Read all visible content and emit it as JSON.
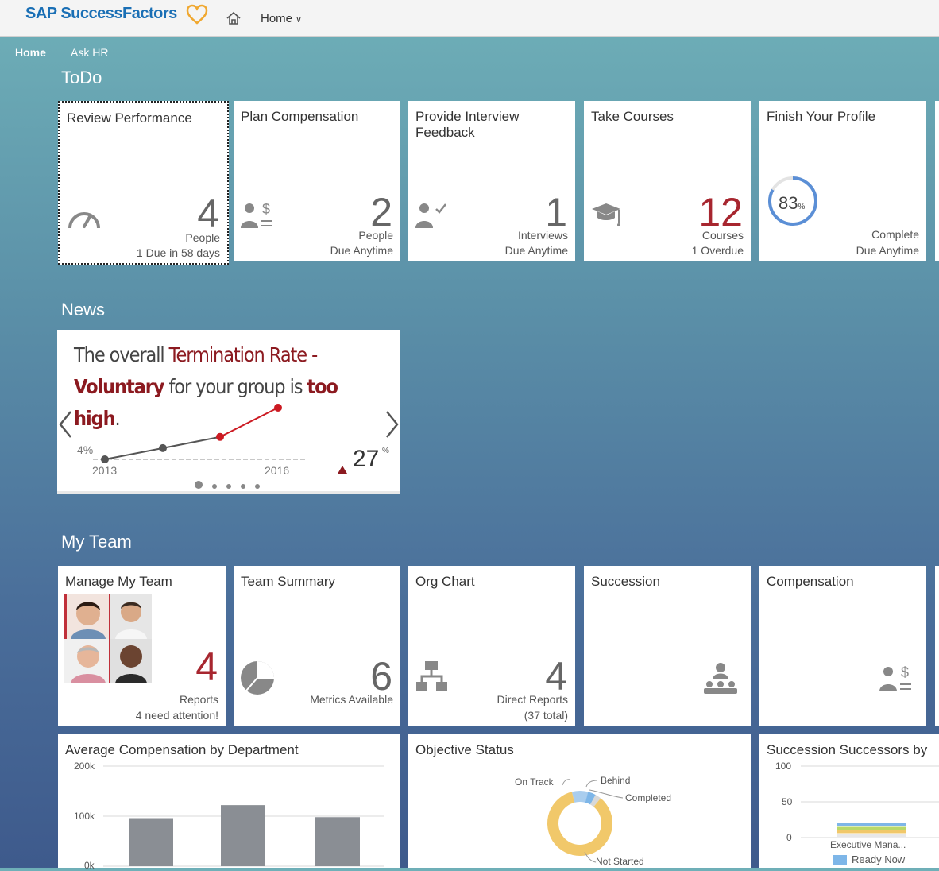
{
  "topbar": {
    "logo": "SAP SuccessFactors",
    "home_menu": "Home"
  },
  "subnav": {
    "home": "Home",
    "ask_hr": "Ask HR"
  },
  "sections": {
    "todo": "ToDo",
    "news": "News",
    "team": "My Team"
  },
  "todo": [
    {
      "title": "Review Performance",
      "number": "4",
      "sub1": "People",
      "sub2": "1 Due in 58 days"
    },
    {
      "title": "Plan Compensation",
      "number": "2",
      "sub1": "People",
      "sub2": "Due Anytime"
    },
    {
      "title": "Provide Interview Feedback",
      "number": "1",
      "sub1": "Interviews",
      "sub2": "Due Anytime"
    },
    {
      "title": "Take Courses",
      "number": "12",
      "sub1": "Courses",
      "sub2": "1 Overdue"
    },
    {
      "title": "Finish Your Profile",
      "number": "83",
      "percent_sign": "%",
      "progress_pct": 83,
      "sub1": "Complete",
      "sub2": "Due Anytime"
    }
  ],
  "news": {
    "line1_a": "The overall ",
    "line1_b": "Termination Rate -",
    "line2_a": "Voluntary",
    "line2_b": " for your group is ",
    "line2_c": "too high",
    "line2_d": ".",
    "y_label": "4%",
    "x_start": "2013",
    "x_end": "2016",
    "value": "27",
    "value_unit": "%"
  },
  "team": [
    {
      "title": "Manage My Team",
      "number": "4",
      "sub1": "Reports",
      "sub2": "4 need attention!"
    },
    {
      "title": "Team Summary",
      "number": "6",
      "sub1": "Metrics Available"
    },
    {
      "title": "Org Chart",
      "number": "4",
      "sub1": "Direct Reports",
      "sub2": "(37 total)"
    },
    {
      "title": "Succession"
    },
    {
      "title": "Compensation"
    }
  ],
  "charts": {
    "avg_comp": {
      "title": "Average Compensation by Department",
      "y_ticks": [
        "200k",
        "100k",
        "0k"
      ]
    },
    "objective": {
      "title": "Objective Status",
      "labels": [
        "On Track",
        "Behind",
        "Completed",
        "Not Started"
      ]
    },
    "succession": {
      "title": "Succession Successors by",
      "y_ticks": [
        "100",
        "50",
        "0"
      ],
      "category": "Executive Mana...",
      "legend": "Ready Now"
    }
  },
  "chart_data": [
    {
      "type": "line",
      "x": [
        "2013",
        "2014",
        "2015",
        "2016"
      ],
      "values": [
        4,
        9,
        14,
        27
      ],
      "unit": "%"
    },
    {
      "type": "bar",
      "title": "Average Compensation by Department",
      "ylim": [
        0,
        200000
      ],
      "values": [
        96000,
        122000,
        98000
      ]
    },
    {
      "type": "pie",
      "title": "Objective Status",
      "categories": [
        "On Track",
        "Behind",
        "Completed",
        "Not Started"
      ],
      "values": [
        8,
        4,
        3,
        85
      ]
    },
    {
      "type": "bar",
      "title": "Succession Successors by",
      "categories": [
        "Executive Mana..."
      ],
      "ylim": [
        0,
        100
      ],
      "series": [
        {
          "name": "Ready Now",
          "values": [
            20
          ]
        }
      ]
    }
  ],
  "colors": {
    "accent_red": "#a7262f",
    "brand_blue": "#1a6fb5",
    "heart_orange": "#f0a830"
  }
}
